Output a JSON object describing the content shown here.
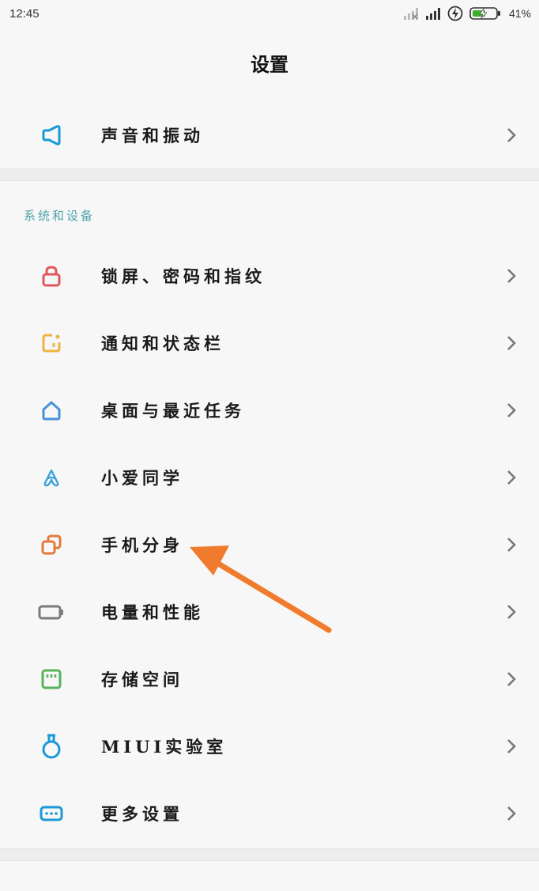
{
  "status_bar": {
    "time": "12:45",
    "battery_percent": "41%",
    "icons": [
      "no-sim-signal-icon",
      "signal-icon",
      "power-saver-icon",
      "battery-charging-icon"
    ]
  },
  "header": {
    "title": "设置"
  },
  "top_items": [
    {
      "label": "声音和振动",
      "icon": "speaker-icon",
      "color": "#1a9ad6"
    }
  ],
  "section": {
    "title": "系统和设备",
    "items": [
      {
        "label": "锁屏、密码和指纹",
        "icon": "lock-icon",
        "color": "#e0565b"
      },
      {
        "label": "通知和状态栏",
        "icon": "notification-icon",
        "color": "#f0b23c"
      },
      {
        "label": "桌面与最近任务",
        "icon": "home-icon",
        "color": "#4a90d9"
      },
      {
        "label": "小爱同学",
        "icon": "xiaoai-icon",
        "color": "#3aa3d9"
      },
      {
        "label": "手机分身",
        "icon": "dual-phone-icon",
        "color": "#e37a3a"
      },
      {
        "label": "电量和性能",
        "icon": "battery-icon",
        "color": "#7a7a7a"
      },
      {
        "label": "存储空间",
        "icon": "storage-icon",
        "color": "#57b35a"
      },
      {
        "label": "MIUI实验室",
        "icon": "lab-flask-icon",
        "color": "#1a9ad6"
      },
      {
        "label": "更多设置",
        "icon": "more-settings-icon",
        "color": "#1a9ad6"
      }
    ]
  },
  "annotation": {
    "arrow_color": "#f07a2e"
  }
}
